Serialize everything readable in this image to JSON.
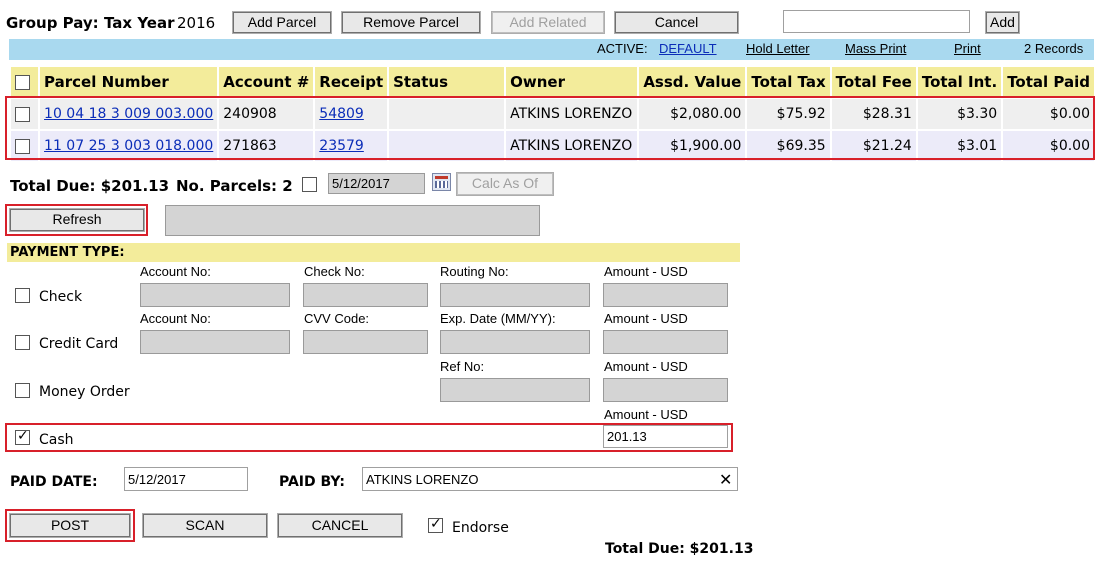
{
  "header": {
    "group_pay_label": "Group Pay:",
    "tax_year_label": "Tax Year",
    "tax_year_value": "2016",
    "add_parcel": "Add Parcel",
    "remove_parcel": "Remove Parcel",
    "add_related": "Add Related",
    "cancel": "Cancel",
    "search_value": "",
    "add": "Add"
  },
  "statusbar": {
    "active_label": "ACTIVE:",
    "active_value": "DEFAULT",
    "hold_letter": "Hold Letter",
    "mass_print": "Mass Print",
    "print": "Print",
    "records": "2 Records"
  },
  "table": {
    "columns": [
      "Parcel Number",
      "Account #",
      "Receipt",
      "Status",
      "Owner",
      "Assd. Value",
      "Total Tax",
      "Total Fee",
      "Total Int.",
      "Total Paid"
    ],
    "rows": [
      {
        "parcel": "10 04 18 3 009 003.000",
        "account": "240908",
        "receipt": "54809",
        "status": "",
        "owner": "ATKINS LORENZO",
        "assd": "$2,080.00",
        "tax": "$75.92",
        "fee": "$28.31",
        "int": "$3.30",
        "paid": "$0.00"
      },
      {
        "parcel": "11 07 25 3 003 018.000",
        "account": "271863",
        "receipt": "23579",
        "status": "",
        "owner": "ATKINS LORENZO",
        "assd": "$1,900.00",
        "tax": "$69.35",
        "fee": "$21.24",
        "int": "$3.01",
        "paid": "$0.00"
      }
    ]
  },
  "summary": {
    "total_due": "Total Due: $201.13",
    "no_parcels": "No. Parcels: 2",
    "calc_date": "5/12/2017",
    "calc_as_of": "Calc As Of",
    "refresh": "Refresh"
  },
  "payment": {
    "title": "PAYMENT TYPE:",
    "check": {
      "label": "Check",
      "f1": "Account No:",
      "f2": "Check No:",
      "f3": "Routing No:",
      "f4": "Amount - USD"
    },
    "credit": {
      "label": "Credit Card",
      "f1": "Account No:",
      "f2": "CVV Code:",
      "f3": "Exp. Date (MM/YY):",
      "f4": "Amount - USD"
    },
    "money": {
      "label": "Money Order",
      "f3": "Ref No:",
      "f4": "Amount - USD"
    },
    "cash": {
      "label": "Cash",
      "f4": "Amount - USD",
      "amount": "201.13"
    }
  },
  "paid": {
    "date_label": "PAID DATE:",
    "date_value": "5/12/2017",
    "by_label": "PAID BY:",
    "by_value": "ATKINS LORENZO"
  },
  "actions": {
    "post": "POST",
    "scan": "SCAN",
    "cancel": "CANCEL",
    "endorse": "Endorse",
    "total_due": "Total Due: $201.13"
  }
}
